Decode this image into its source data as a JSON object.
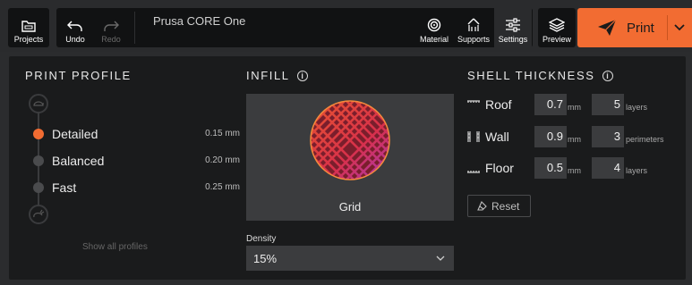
{
  "toolbar": {
    "projects_label": "Projects",
    "undo_label": "Undo",
    "redo_label": "Redo",
    "printer_name": "Prusa CORE One",
    "material_label": "Material",
    "supports_label": "Supports",
    "settings_label": "Settings",
    "preview_label": "Preview",
    "print_label": "Print"
  },
  "print_profile": {
    "title": "PRINT PROFILE",
    "items": [
      {
        "name": "Detailed",
        "value": "0.15 mm",
        "active": true
      },
      {
        "name": "Balanced",
        "value": "0.20 mm",
        "active": false
      },
      {
        "name": "Fast",
        "value": "0.25 mm",
        "active": false
      }
    ],
    "show_all_label": "Show all profiles"
  },
  "infill": {
    "title": "INFILL",
    "pattern_name": "Grid",
    "density_label": "Density",
    "density_value": "15%"
  },
  "shell_thickness": {
    "title": "SHELL THICKNESS",
    "rows": [
      {
        "label": "Roof",
        "value": "0.7",
        "unit": "mm",
        "count": "5",
        "count_unit": "layers"
      },
      {
        "label": "Wall",
        "value": "0.9",
        "unit": "mm",
        "count": "3",
        "count_unit": "perimeters"
      },
      {
        "label": "Floor",
        "value": "0.5",
        "unit": "mm",
        "count": "4",
        "count_unit": "layers"
      }
    ],
    "reset_label": "Reset"
  },
  "colors": {
    "accent": "#f26c32",
    "panel_bg": "#1a1b1c",
    "field_bg": "#3b3c3e"
  }
}
